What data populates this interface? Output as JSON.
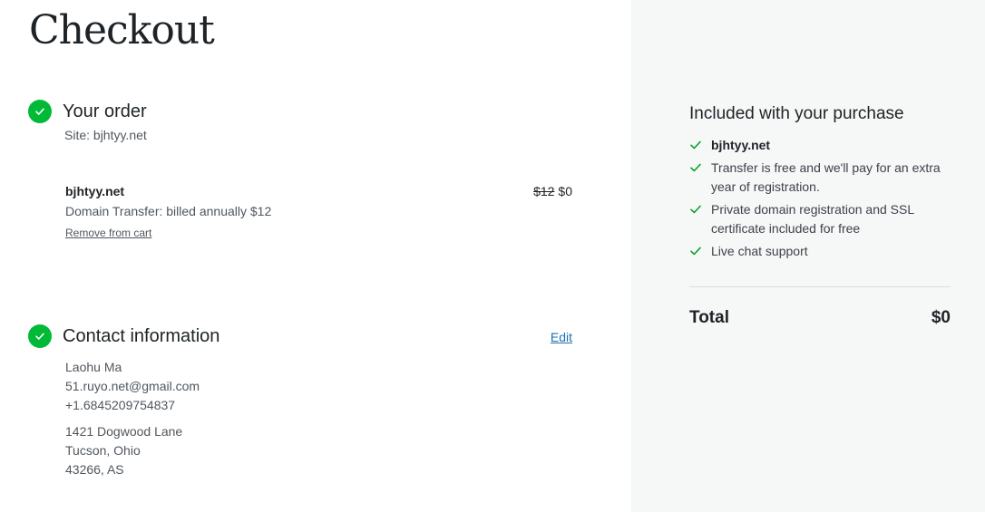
{
  "page": {
    "title": "Checkout"
  },
  "order": {
    "title": "Your order",
    "site_line": "Site: bjhtyy.net",
    "item": {
      "name": "bjhtyy.net",
      "description": "Domain Transfer: billed annually $12",
      "original_price": "$12",
      "price": "$0",
      "remove_label": "Remove from cart"
    }
  },
  "contact": {
    "title": "Contact information",
    "edit_label": "Edit",
    "name": "Laohu Ma",
    "email": "51.ruyo.net@gmail.com",
    "phone": "+1.6845209754837",
    "address_line1": "1421 Dogwood Lane",
    "address_line2": "Tucson, Ohio",
    "address_line3": "43266, AS"
  },
  "sidebar": {
    "title": "Included with your purchase",
    "items": [
      {
        "label": "bjhtyy.net"
      },
      {
        "label": "Transfer is free and we'll pay for an extra year of registration."
      },
      {
        "label": "Private domain registration and SSL certificate included for free"
      },
      {
        "label": "Live chat support"
      }
    ],
    "total_label": "Total",
    "total_value": "$0"
  },
  "colors": {
    "accent_green": "#00ba37",
    "link_blue": "#2271b1",
    "sidebar_bg": "#f6f7f7"
  },
  "icons": {
    "step_complete": "checkmark-circle-icon",
    "included": "checkmark-icon"
  }
}
